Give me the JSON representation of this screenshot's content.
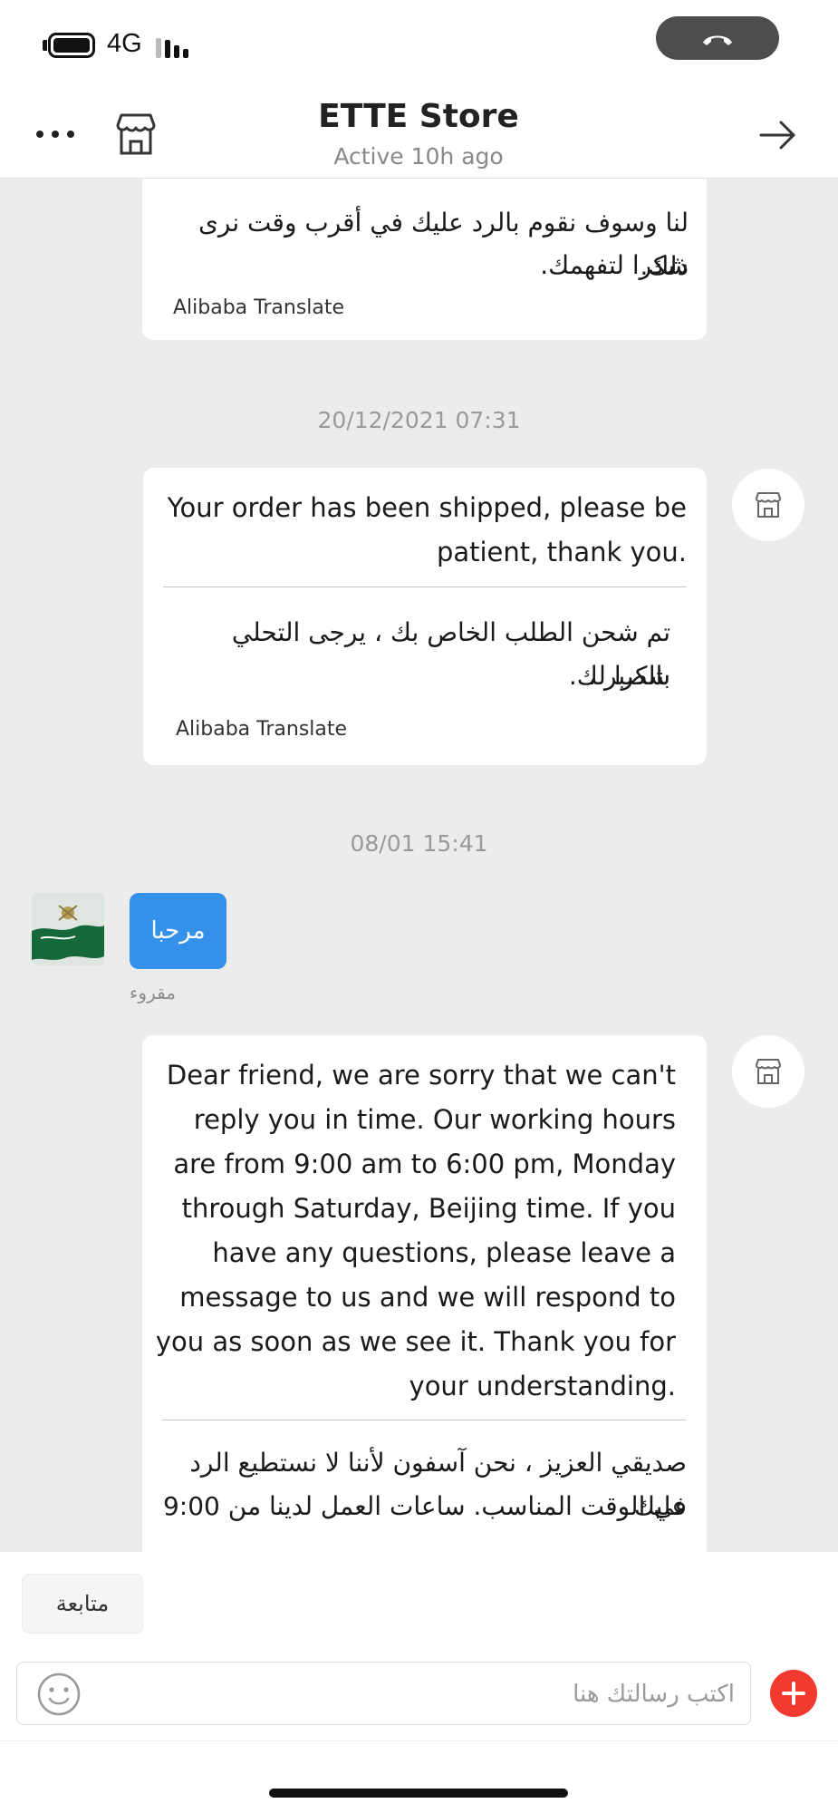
{
  "status_bar": {
    "network": "4G"
  },
  "header": {
    "title": "ETTE Store",
    "subtitle": "Active 10h ago"
  },
  "messages": [
    {
      "id": "m1",
      "arabic_lines": [
        "لنا وسوف نقوم بالرد عليك في أقرب وقت نرى ذلك.",
        "شكرا لتفهمك."
      ],
      "translator": "Alibaba Translate"
    },
    {
      "id": "m2",
      "timestamp": "20/12/2021 07:31",
      "english_lines": [
        "Your order has been shipped, please be",
        "patient, thank you."
      ],
      "arabic_lines": [
        "تم شحن الطلب الخاص بك ، يرجى التحلي بالصبر ،",
        "شكرا لك."
      ],
      "translator": "Alibaba Translate"
    },
    {
      "id": "m3",
      "timestamp": "08/01 15:41",
      "user_text": "مرحبا",
      "read_status": "مقروء"
    },
    {
      "id": "m4",
      "english_lines": [
        "Dear friend, we are sorry that we can't",
        "reply you in time. Our working hours",
        "are from 9:00 am to 6:00 pm, Monday",
        "through Saturday, Beijing time. If you",
        "have any questions, please leave a",
        "message to us and we will respond to",
        "you as soon as we see it. Thank you for",
        "your understanding."
      ],
      "arabic_lines": [
        "صديقي العزيز ، نحن آسفون لأننا لا نستطيع الرد عليك",
        "في الوقت المناسب. ساعات العمل لدينا من 9:00"
      ]
    }
  ],
  "footer": {
    "follow_label": "متابعة",
    "input_placeholder": "اكتب رسالتك هنا"
  },
  "colors": {
    "chat_background": "#ececec",
    "user_bubble": "#3590ea",
    "add_button": "#f23b2e"
  }
}
